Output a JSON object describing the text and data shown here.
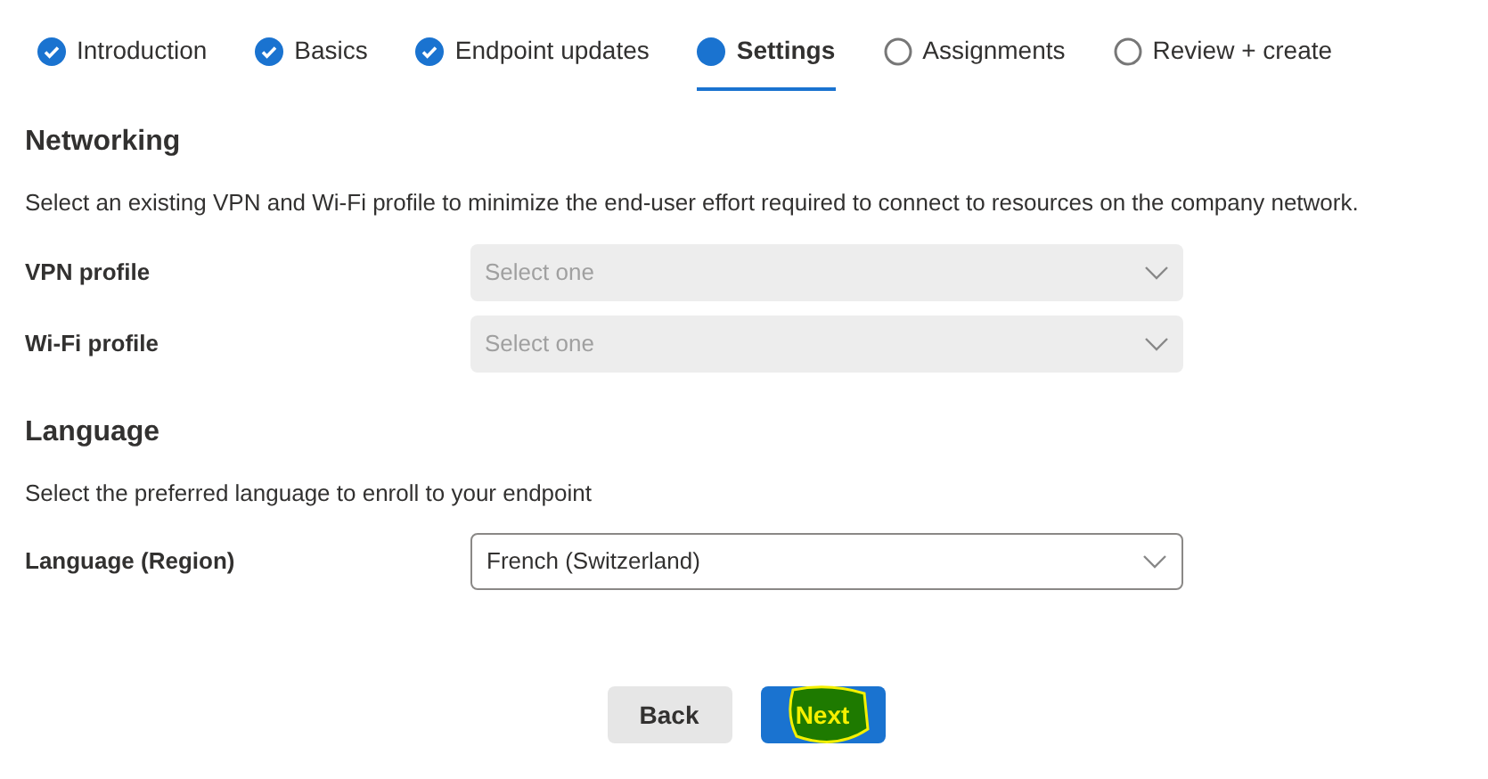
{
  "steps": [
    {
      "label": "Introduction",
      "completed": true,
      "selected": false
    },
    {
      "label": "Basics",
      "completed": true,
      "selected": false
    },
    {
      "label": "Endpoint updates",
      "completed": true,
      "selected": false
    },
    {
      "label": "Settings",
      "completed": false,
      "selected": true
    },
    {
      "label": "Assignments",
      "completed": false,
      "selected": false
    },
    {
      "label": "Review + create",
      "completed": false,
      "selected": false
    }
  ],
  "sections": [
    {
      "heading": "Networking",
      "description": "Select an existing VPN and Wi-Fi profile to minimize the end-user effort required to connect to resources on the company network.",
      "fields": [
        {
          "label": "VPN profile",
          "placeholder": "Select one",
          "disabled": true
        },
        {
          "label": "Wi-Fi profile",
          "placeholder": "Select one",
          "disabled": true
        }
      ]
    },
    {
      "heading": "Language",
      "description": "Select the preferred language to enroll to your endpoint",
      "fields": [
        {
          "label": "Language (Region)",
          "value": "French (Switzerland)",
          "disabled": false
        }
      ]
    }
  ],
  "buttons": [
    {
      "label": "Back",
      "kind": "secondary",
      "highlighted": false
    },
    {
      "label": "Next",
      "kind": "primary",
      "highlighted": true
    }
  ]
}
